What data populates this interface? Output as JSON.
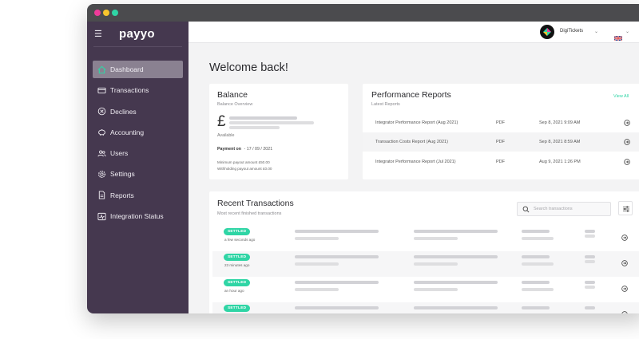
{
  "window_controls": {
    "colors": [
      "#ee3b9a",
      "#f7c52d",
      "#2fd5a5"
    ]
  },
  "sidebar": {
    "brand": "payyo",
    "items": [
      {
        "label": "Dashboard",
        "icon": "home-icon",
        "active": true
      },
      {
        "label": "Transactions",
        "icon": "card-icon",
        "active": false
      },
      {
        "label": "Declines",
        "icon": "x-circle-icon",
        "active": false
      },
      {
        "label": "Accounting",
        "icon": "piggy-bank-icon",
        "active": false
      },
      {
        "label": "Users",
        "icon": "users-icon",
        "active": false
      },
      {
        "label": "Settings",
        "icon": "gear-icon",
        "active": false
      },
      {
        "label": "Reports",
        "icon": "document-icon",
        "active": false
      },
      {
        "label": "Integration Status",
        "icon": "activity-icon",
        "active": false
      }
    ]
  },
  "topbar": {
    "merchant": "DigiTickets",
    "language_flag": "uk-flag-icon"
  },
  "welcome": "Welcome back!",
  "balance": {
    "title": "Balance",
    "subtitle": "Balance Overview",
    "currency_symbol": "£",
    "available_label": "Available",
    "payment_on_label": "Payment on",
    "payment_date": "- 17 / 09 / 2021",
    "min_payout": "Minimum payout amount £50.00",
    "withholding": "Withholding payout amount £0.00"
  },
  "reports": {
    "title": "Performance Reports",
    "subtitle": "Latest Reports",
    "view_all": "View All",
    "rows": [
      {
        "name": "Integrator Performance Report (Aug 2021)",
        "type": "PDF",
        "date": "Sep 8, 2021 9:09 AM"
      },
      {
        "name": "Transaction Costs Report (Aug 2021)",
        "type": "PDF",
        "date": "Sep 8, 2021 8:59 AM"
      },
      {
        "name": "Integrator Performance Report (Jul 2021)",
        "type": "PDF",
        "date": "Aug 9, 2021 1:26 PM"
      }
    ]
  },
  "transactions": {
    "title": "Recent Transactions",
    "subtitle": "Most recent finished transactions",
    "search_placeholder": "Search transactions",
    "rows": [
      {
        "status": "SETTLED",
        "time": "a few seconds ago"
      },
      {
        "status": "SETTLED",
        "time": "23 minutes ago"
      },
      {
        "status": "SETTLED",
        "time": "an hour ago"
      },
      {
        "status": "SETTLED",
        "time": ""
      }
    ]
  },
  "colors": {
    "sidebar": "#45384f",
    "accent": "#2fd5a5",
    "active_item": "#8a8191"
  }
}
